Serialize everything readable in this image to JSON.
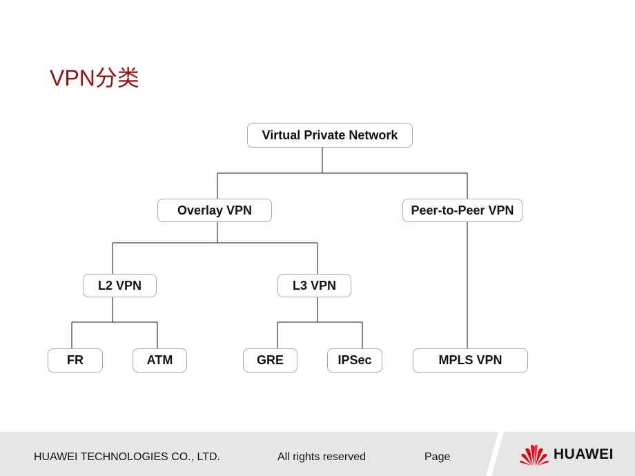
{
  "slide": {
    "title": "VPN分类",
    "accent_color": "#9b0f12"
  },
  "diagram": {
    "nodes": {
      "root": "Virtual Private Network",
      "overlay": "Overlay VPN",
      "p2p": "Peer-to-Peer VPN",
      "l2": "L2 VPN",
      "l3": "L3 VPN",
      "fr": "FR",
      "atm": "ATM",
      "gre": "GRE",
      "ipsec": "IPSec",
      "mpls": "MPLS VPN"
    },
    "edges": [
      [
        "root",
        "overlay"
      ],
      [
        "root",
        "p2p"
      ],
      [
        "overlay",
        "l2"
      ],
      [
        "overlay",
        "l3"
      ],
      [
        "l2",
        "fr"
      ],
      [
        "l2",
        "atm"
      ],
      [
        "l3",
        "gre"
      ],
      [
        "l3",
        "ipsec"
      ],
      [
        "p2p",
        "mpls"
      ]
    ]
  },
  "footer": {
    "company": "HUAWEI TECHNOLOGIES CO., LTD.",
    "rights": "All rights reserved",
    "page_label": "Page",
    "logo_text": "HUAWEI",
    "logo_color": "#e60012"
  }
}
